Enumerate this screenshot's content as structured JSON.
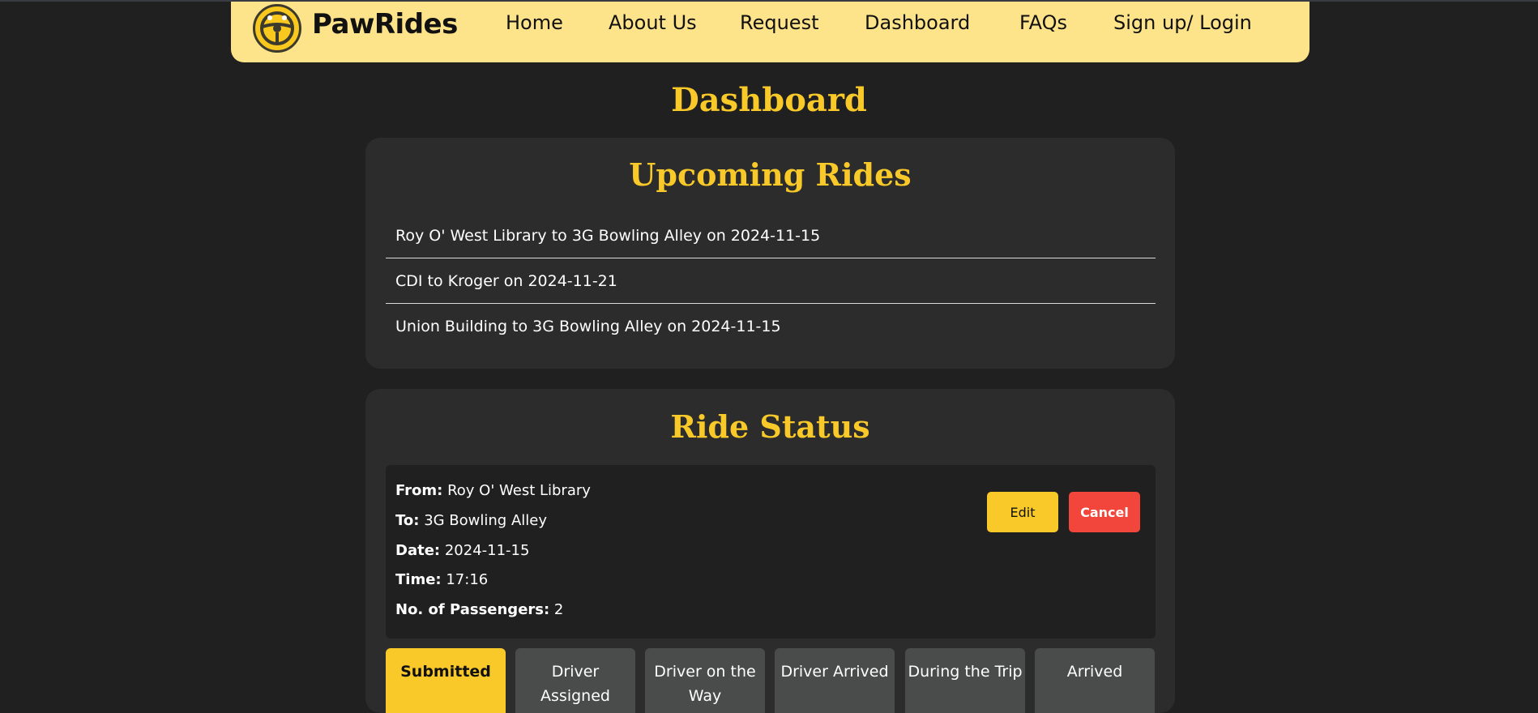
{
  "brand": {
    "name": "PawRides"
  },
  "nav": {
    "items": [
      "Home",
      "About Us",
      "Request",
      "Dashboard",
      "FAQs",
      "Sign up/ Login"
    ]
  },
  "page": {
    "title": "Dashboard"
  },
  "upcoming": {
    "title": "Upcoming Rides",
    "rides": [
      "Roy O' West Library to 3G Bowling Alley on 2024-11-15",
      "CDI to Kroger on 2024-11-21",
      "Union Building to 3G Bowling Alley on 2024-11-15"
    ]
  },
  "status": {
    "title": "Ride Status",
    "from_label": "From:",
    "from_value": "Roy O' West Library",
    "to_label": "To:",
    "to_value": "3G Bowling Alley",
    "date_label": "Date:",
    "date_value": "2024-11-15",
    "time_label": "Time:",
    "time_value": "17:16",
    "passengers_label": "No. of Passengers:",
    "passengers_value": "2",
    "edit_label": "Edit",
    "cancel_label": "Cancel",
    "steps": [
      "Submitted",
      "Driver Assigned",
      "Driver on the Way",
      "Driver Arrived",
      "During the Trip",
      "Arrived"
    ],
    "active_step": "Submitted"
  },
  "colors": {
    "background": "#1f201f",
    "navbar": "#fde38a",
    "accent": "#f8c929",
    "danger": "#f2453b",
    "card": "#2b2c2b"
  }
}
